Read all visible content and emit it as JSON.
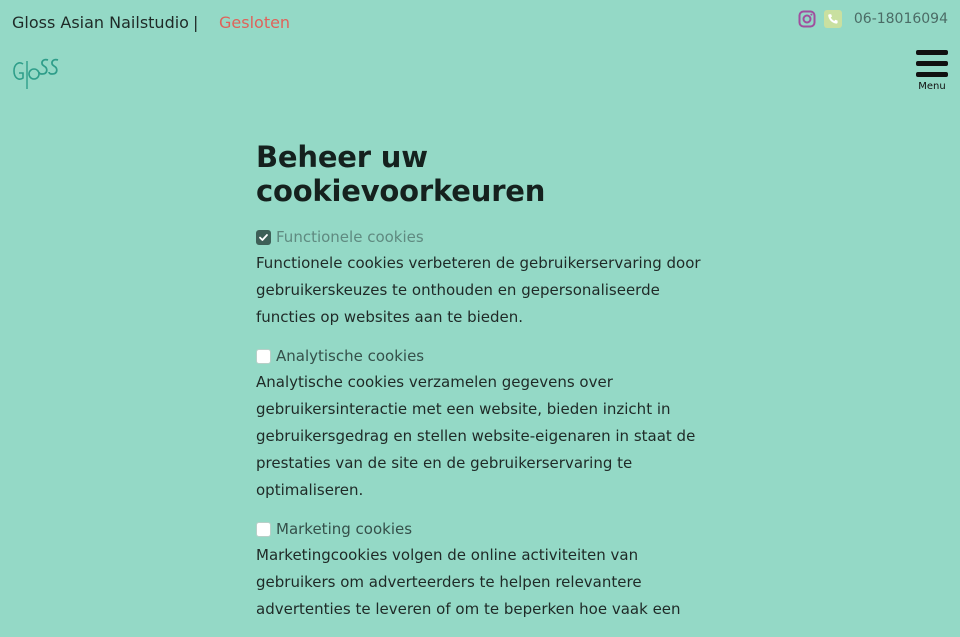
{
  "header": {
    "site_name": "Gloss Asian Nailstudio",
    "separator": "|",
    "status": "Gesloten",
    "phone": "06-18016094",
    "instagram_icon": "instagram-icon",
    "phone_icon": "phone-icon"
  },
  "logo": {
    "text": "Gloss"
  },
  "menu": {
    "label": "Menu"
  },
  "main": {
    "title": "Beheer uw cookievoorkeuren",
    "preferences": [
      {
        "label": "Functionele cookies",
        "checked": true,
        "description": "Functionele cookies verbeteren de gebruikerservaring door gebruikerskeuzes te onthouden en gepersonaliseerde functies op websites aan te bieden."
      },
      {
        "label": "Analytische cookies",
        "checked": false,
        "description": "Analytische cookies verzamelen gegevens over gebruikersinteractie met een website, bieden inzicht in gebruikersgedrag en stellen website-eigenaren in staat de prestaties van de site en de gebruikerservaring te optimaliseren."
      },
      {
        "label": "Marketing cookies",
        "checked": false,
        "description": "Marketingcookies volgen de online activiteiten van gebruikers om adverteerders te helpen relevantere advertenties te leveren of om te beperken hoe vaak een"
      }
    ]
  },
  "colors": {
    "background": "#94d9c6",
    "status": "#e0625a",
    "checkbox_checked": "#3e5f57"
  }
}
